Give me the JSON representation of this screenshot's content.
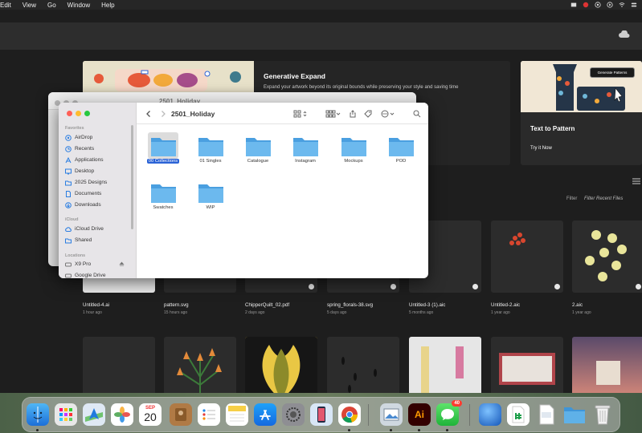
{
  "menubar": {
    "items": [
      "Edit",
      "View",
      "Go",
      "Window",
      "Help"
    ]
  },
  "banner": {
    "gen_title": "Generative Expand",
    "gen_desc": "Expand your artwork beyond its original bounds while preserving your style and saving time",
    "ttp_title": "Text to Pattern",
    "ttp_link": "Try it Now",
    "ttp_button": "Generate Patterns"
  },
  "recent": {
    "filter_label": "Filter",
    "filter_placeholder": "Filter Recent Files"
  },
  "files": [
    {
      "name": "Untitled-4.ai",
      "date": "1 hour ago"
    },
    {
      "name": "pattern.svg",
      "date": "15 hours ago"
    },
    {
      "name": "ChipperQuilt_02.pdf",
      "date": "2 days ago"
    },
    {
      "name": "spring_florals-38.svg",
      "date": "5 days ago"
    },
    {
      "name": "Untitled-3 (1).aic",
      "date": "5 months ago"
    },
    {
      "name": "Untitled-2.aic",
      "date": "1 year ago"
    },
    {
      "name": "2.aic",
      "date": "1 year ago"
    }
  ],
  "back_finder": {
    "title": "2501_Holiday"
  },
  "finder": {
    "title": "2501_Holiday",
    "sidebar": {
      "favorites_label": "Favorites",
      "favorites": [
        "AirDrop",
        "Recents",
        "Applications",
        "Desktop",
        "2025 Designs",
        "Documents",
        "Downloads"
      ],
      "icloud_label": "iCloud",
      "icloud": [
        "iCloud Drive",
        "Shared"
      ],
      "locations_label": "Locations",
      "locations": [
        "X9 Pro",
        "Google Drive"
      ]
    },
    "folders": [
      "00 Collections",
      "01 Singles",
      "Catalogue",
      "Instagram",
      "Mockups",
      "POD",
      "Swatches",
      "WIP"
    ],
    "selected_folder": "00 Collections"
  },
  "dock": {
    "calendar_month": "SEP",
    "calendar_day": "20",
    "messages_badge": "40",
    "illustrator_label": "Ai",
    "accent": "#2a62d6",
    "folder_color": "#5fb1e8"
  }
}
